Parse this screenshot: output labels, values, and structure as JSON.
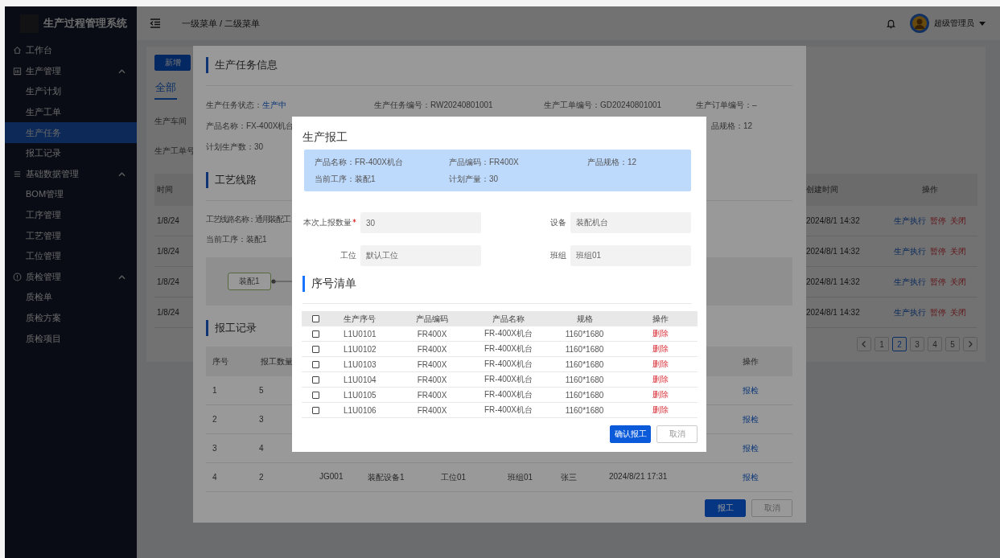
{
  "sidebar": {
    "title": "生产过程管理系统",
    "items": [
      {
        "label": "工作台",
        "kind": "link",
        "selected": false
      },
      {
        "label": "生产管理",
        "kind": "group",
        "expanded": true,
        "children": [
          {
            "label": "生产计划",
            "selected": false
          },
          {
            "label": "生产工单",
            "selected": false
          },
          {
            "label": "生产任务",
            "selected": true
          },
          {
            "label": "报工记录",
            "selected": false
          }
        ]
      },
      {
        "label": "基础数据管理",
        "kind": "group",
        "expanded": true,
        "children": [
          {
            "label": "BOM管理",
            "selected": false
          },
          {
            "label": "工序管理",
            "selected": false
          },
          {
            "label": "工艺管理",
            "selected": false
          },
          {
            "label": "工位管理",
            "selected": false
          }
        ]
      },
      {
        "label": "质检管理",
        "kind": "group",
        "expanded": true,
        "children": [
          {
            "label": "质检单",
            "selected": false
          },
          {
            "label": "质检方案",
            "selected": false
          },
          {
            "label": "质检项目",
            "selected": false
          }
        ]
      }
    ]
  },
  "header": {
    "breadcrumb": "一级菜单 / 二级菜单",
    "user": "超级管理员"
  },
  "page": {
    "add_button": "新增",
    "tabs": [
      {
        "label": "全部",
        "selected": true
      }
    ],
    "filters": [
      "生产车间",
      "生产工单号"
    ],
    "table": {
      "columns": {
        "left": "时间",
        "right": [
          "创建时间",
          "操作"
        ]
      },
      "rows": [
        {
          "time": "1/8/24",
          "created": "2024/8/1 14:32",
          "actions": [
            {
              "label": "生产执行",
              "kind": "primary"
            },
            {
              "label": "暂停",
              "kind": "danger"
            },
            {
              "label": "关闭",
              "kind": "danger"
            }
          ]
        },
        {
          "time": "1/8/24",
          "created": "2024/8/1 14:32",
          "actions": [
            {
              "label": "生产执行",
              "kind": "primary"
            },
            {
              "label": "暂停",
              "kind": "danger"
            },
            {
              "label": "关闭",
              "kind": "danger"
            }
          ]
        },
        {
          "time": "1/8/24",
          "created": "2024/8/1 14:32",
          "actions": [
            {
              "label": "生产执行",
              "kind": "primary"
            },
            {
              "label": "暂停",
              "kind": "danger"
            },
            {
              "label": "关闭",
              "kind": "danger"
            }
          ]
        },
        {
          "time": "1/8/24",
          "created": "2024/8/1 14:32",
          "actions": [
            {
              "label": "生产执行",
              "kind": "primary"
            },
            {
              "label": "暂停",
              "kind": "danger"
            },
            {
              "label": "关闭",
              "kind": "danger"
            }
          ]
        }
      ]
    },
    "pagination": [
      {
        "label": "1",
        "selected": false
      },
      {
        "label": "2",
        "selected": true
      },
      {
        "label": "3",
        "selected": false
      },
      {
        "label": "4",
        "selected": false
      },
      {
        "label": "5",
        "selected": false
      }
    ]
  },
  "task_dialog": {
    "title": "生产任务信息",
    "info_rows": [
      [
        {
          "label": "生产任务状态：",
          "value": "生产中",
          "kind": "status"
        },
        {
          "label": "生产任务编号：",
          "value": "RW20240801001",
          "kind": "text"
        },
        {
          "label": "生产工单编号：",
          "value": "GD20240801001",
          "kind": "text"
        },
        {
          "label": "生产订单编号：",
          "value": "–",
          "kind": "text"
        }
      ],
      [
        {
          "label": "产品名称：",
          "value": "FX-400X机台",
          "kind": "text"
        },
        {
          "label": "品规格：",
          "value": "12",
          "kind": "text"
        }
      ],
      [
        {
          "label": "计划生产数：",
          "value": "30",
          "kind": "text"
        }
      ]
    ],
    "route": {
      "title": "工艺线路",
      "name": "工艺线路名称：通用装配工",
      "current": "当前工序：装配1",
      "nodes": [
        "装配1"
      ]
    },
    "records": {
      "title": "报工记录",
      "columns": [
        "序号",
        "报工数量",
        "操作"
      ],
      "rows": [
        {
          "index": "1",
          "quantity": "5",
          "action": "报检"
        },
        {
          "index": "2",
          "quantity": "3",
          "action": "报检"
        },
        {
          "index": "3",
          "quantity": "4",
          "action": "报检"
        },
        {
          "index": "4",
          "quantity": "2",
          "details": [
            "JG001",
            "装配设备1",
            "工位01",
            "班组01",
            "张三",
            "2024/8/21 17:31"
          ],
          "action": "报检"
        }
      ]
    },
    "buttons": [
      {
        "label": "报工",
        "kind": "primary"
      },
      {
        "label": "取消",
        "kind": "default"
      }
    ]
  },
  "report_dialog": {
    "title": "生产报工",
    "summary": [
      [
        {
          "label": "产品名称：",
          "value": "FR-400X机台"
        },
        {
          "label": "产品编码：",
          "value": "FR400X"
        },
        {
          "label": "产品规格：",
          "value": "12"
        }
      ],
      [
        {
          "label": "当前工序：",
          "value": "装配1"
        },
        {
          "label": "计划产量：",
          "value": "30"
        }
      ]
    ],
    "fields": [
      {
        "label": "本次上报数量",
        "required": true,
        "value": "30"
      },
      {
        "label": "设备",
        "required": false,
        "value": "装配机台"
      },
      {
        "label": "工位",
        "required": false,
        "value": "默认工位"
      },
      {
        "label": "班组",
        "required": false,
        "value": "班组01"
      }
    ],
    "serials": {
      "title": "序号清单",
      "select_all": false,
      "columns": [
        "生产序号",
        "产品编码",
        "产品名称",
        "规格",
        "操作"
      ],
      "rows": [
        {
          "checked": false,
          "serial": "L1U0101",
          "code": "FR400X",
          "name": "FR-400X机台",
          "spec": "1160*1680",
          "action": "删除"
        },
        {
          "checked": false,
          "serial": "L1U0102",
          "code": "FR400X",
          "name": "FR-400X机台",
          "spec": "1160*1680",
          "action": "删除"
        },
        {
          "checked": false,
          "serial": "L1U0103",
          "code": "FR400X",
          "name": "FR-400X机台",
          "spec": "1160*1680",
          "action": "删除"
        },
        {
          "checked": false,
          "serial": "L1U0104",
          "code": "FR400X",
          "name": "FR-400X机台",
          "spec": "1160*1680",
          "action": "删除"
        },
        {
          "checked": false,
          "serial": "L1U0105",
          "code": "FR400X",
          "name": "FR-400X机台",
          "spec": "1160*1680",
          "action": "删除"
        },
        {
          "checked": false,
          "serial": "L1U0106",
          "code": "FR400X",
          "name": "FR-400X机台",
          "spec": "1160*1680",
          "action": "删除"
        }
      ]
    },
    "buttons": [
      {
        "label": "确认报工",
        "kind": "primary"
      },
      {
        "label": "取消",
        "kind": "default"
      }
    ]
  }
}
